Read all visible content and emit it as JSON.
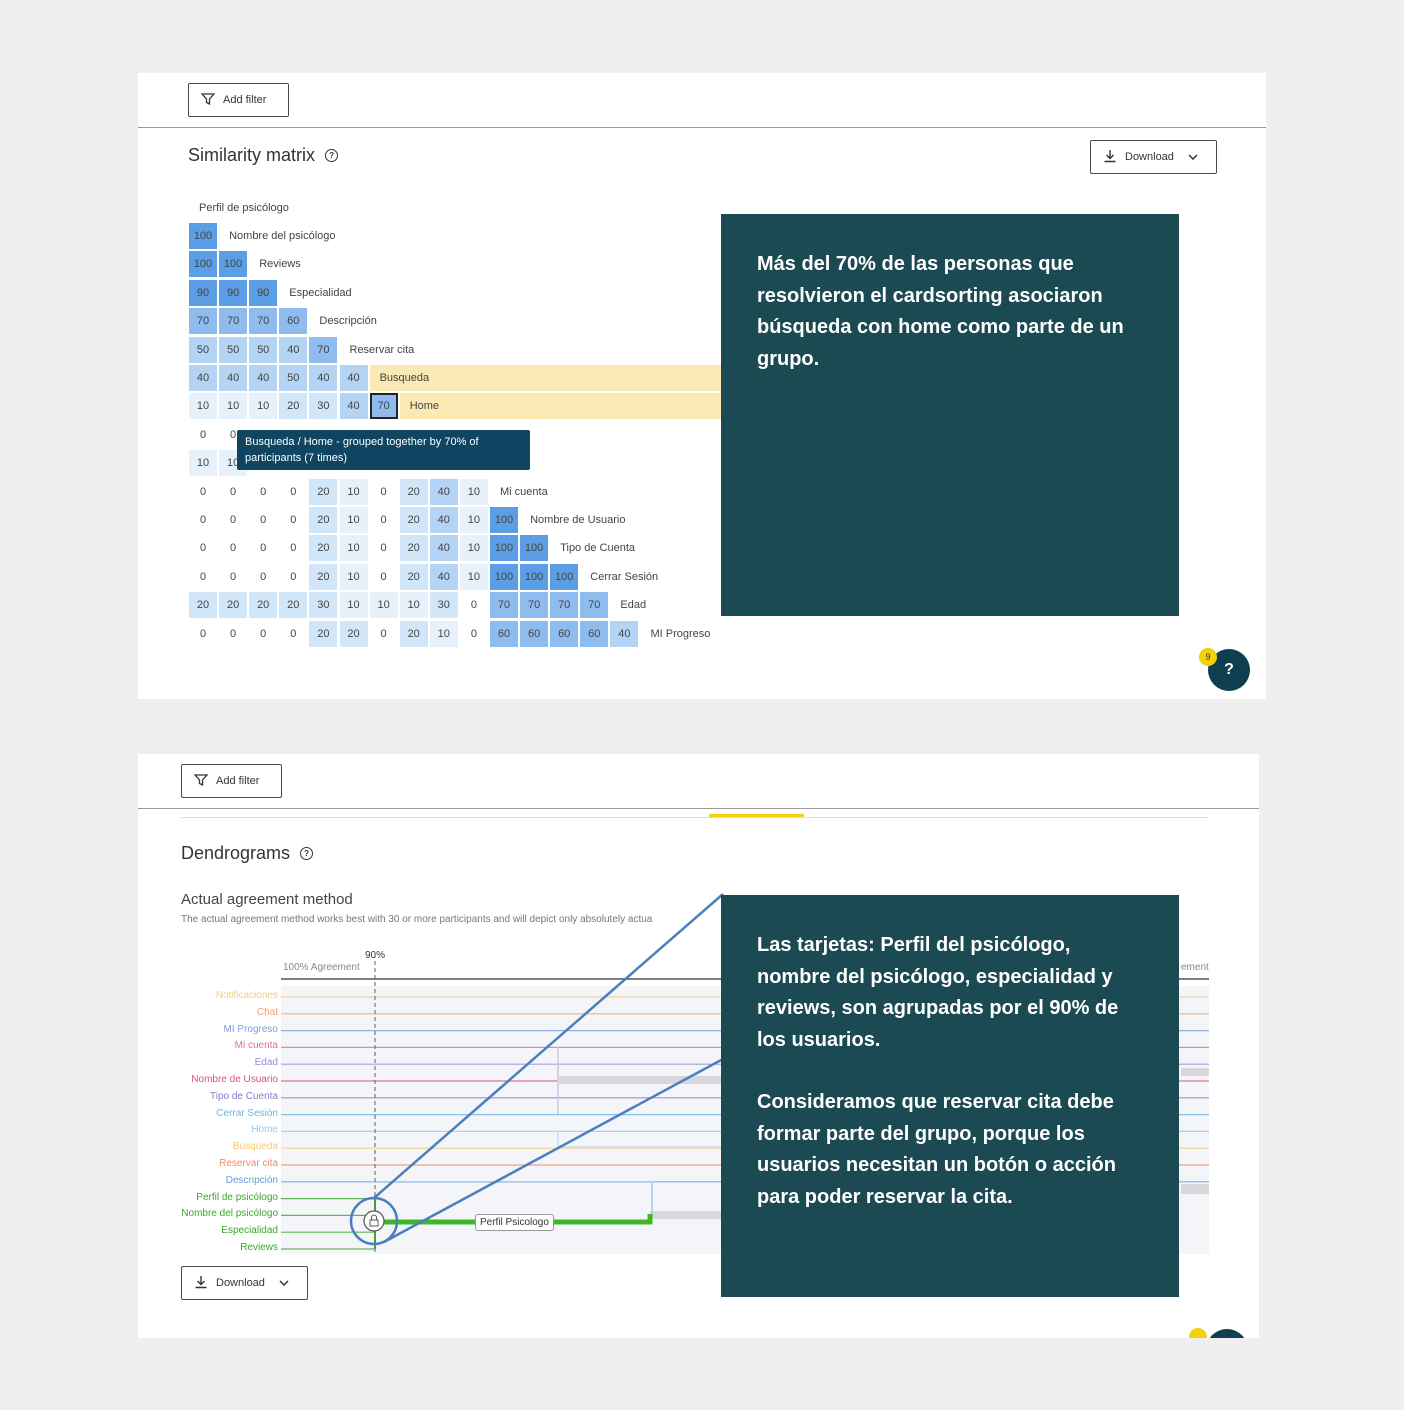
{
  "top": {
    "add_filter": "Add filter",
    "title": "Similarity matrix",
    "download": "Download",
    "header_label": "Perfil de psicólogo",
    "rows": [
      {
        "label": "Nombre del psicólogo",
        "values": [
          100
        ]
      },
      {
        "label": "Reviews",
        "values": [
          100,
          100
        ]
      },
      {
        "label": "Especialidad",
        "values": [
          90,
          90,
          90
        ]
      },
      {
        "label": "Descripción",
        "values": [
          70,
          70,
          70,
          60
        ]
      },
      {
        "label": "Reservar cita",
        "values": [
          50,
          50,
          50,
          40,
          70
        ]
      },
      {
        "label": "Busqueda",
        "values": [
          40,
          40,
          40,
          50,
          40,
          40
        ]
      },
      {
        "label": "Home",
        "values": [
          10,
          10,
          10,
          20,
          30,
          40,
          70
        ]
      },
      {
        "label": "",
        "values": [
          0,
          0
        ]
      },
      {
        "label": "",
        "values": [
          10,
          10
        ]
      },
      {
        "label": "Mi cuenta",
        "values": [
          0,
          0,
          0,
          0,
          20,
          10,
          0,
          20,
          40,
          10
        ]
      },
      {
        "label": "Nombre de Usuario",
        "values": [
          0,
          0,
          0,
          0,
          20,
          10,
          0,
          20,
          40,
          10,
          100
        ]
      },
      {
        "label": "Tipo de Cuenta",
        "values": [
          0,
          0,
          0,
          0,
          20,
          10,
          0,
          20,
          40,
          10,
          100,
          100
        ]
      },
      {
        "label": "Cerrar Sesión",
        "values": [
          0,
          0,
          0,
          0,
          20,
          10,
          0,
          20,
          40,
          10,
          100,
          100,
          100
        ]
      },
      {
        "label": "Edad",
        "values": [
          20,
          20,
          20,
          20,
          30,
          10,
          10,
          10,
          30,
          0,
          70,
          70,
          70,
          70
        ]
      },
      {
        "label": "MI Progreso",
        "values": [
          0,
          0,
          0,
          0,
          20,
          20,
          0,
          20,
          10,
          0,
          60,
          60,
          60,
          60,
          40
        ]
      }
    ],
    "tooltip": "Busqueda / Home - grouped together by 70% of participants (7 times)",
    "callout": "Más del 70% de las personas que resolvieron el cardsorting asociaron búsqueda con home como parte de un grupo.",
    "help_fab": "?",
    "badge": "9"
  },
  "bottom": {
    "add_filter": "Add filter",
    "title": "Dendrograms",
    "method_title": "Actual agreement method",
    "method_desc": "The actual agreement method works best with 30 or more participants and will depict only absolutely actua",
    "pct_label": "90%",
    "agreement_label": "100% Agreement",
    "agreement_right": "ement",
    "labels": [
      {
        "text": "Notificaciones",
        "color": "#f5c98a"
      },
      {
        "text": "Chat",
        "color": "#f0a070"
      },
      {
        "text": "MI Progreso",
        "color": "#7a9ee0"
      },
      {
        "text": "Mi cuenta",
        "color": "#e0709a"
      },
      {
        "text": "Edad",
        "color": "#9a8ad8"
      },
      {
        "text": "Nombre de Usuario",
        "color": "#e0507a"
      },
      {
        "text": "Tipo de Cuenta",
        "color": "#8a78d0"
      },
      {
        "text": "Cerrar Sesión",
        "color": "#6ab6e0"
      },
      {
        "text": "Home",
        "color": "#9ac8f0"
      },
      {
        "text": "Busqueda",
        "color": "#f5c870"
      },
      {
        "text": "Reservar cita",
        "color": "#f08a60"
      },
      {
        "text": "Descripción",
        "color": "#6a9ae0"
      },
      {
        "text": "Perfil de psicólogo",
        "color": "#3aa82a"
      },
      {
        "text": "Nombre del psicólogo",
        "color": "#3aa82a"
      },
      {
        "text": "Especialidad",
        "color": "#3aa82a"
      },
      {
        "text": "Reviews",
        "color": "#3aa82a"
      }
    ],
    "cluster_label": "Perfil Psicologo",
    "download": "Download",
    "callout_p1": "Las tarjetas: Perfil del psicólogo, nombre del psicólogo, especialidad y reviews, son agrupadas por el 90% de los usuarios.",
    "callout_p2": "Consideramos que reservar cita debe formar parte del grupo, porque los usuarios necesitan un botón o acción para poder reservar la cita."
  }
}
